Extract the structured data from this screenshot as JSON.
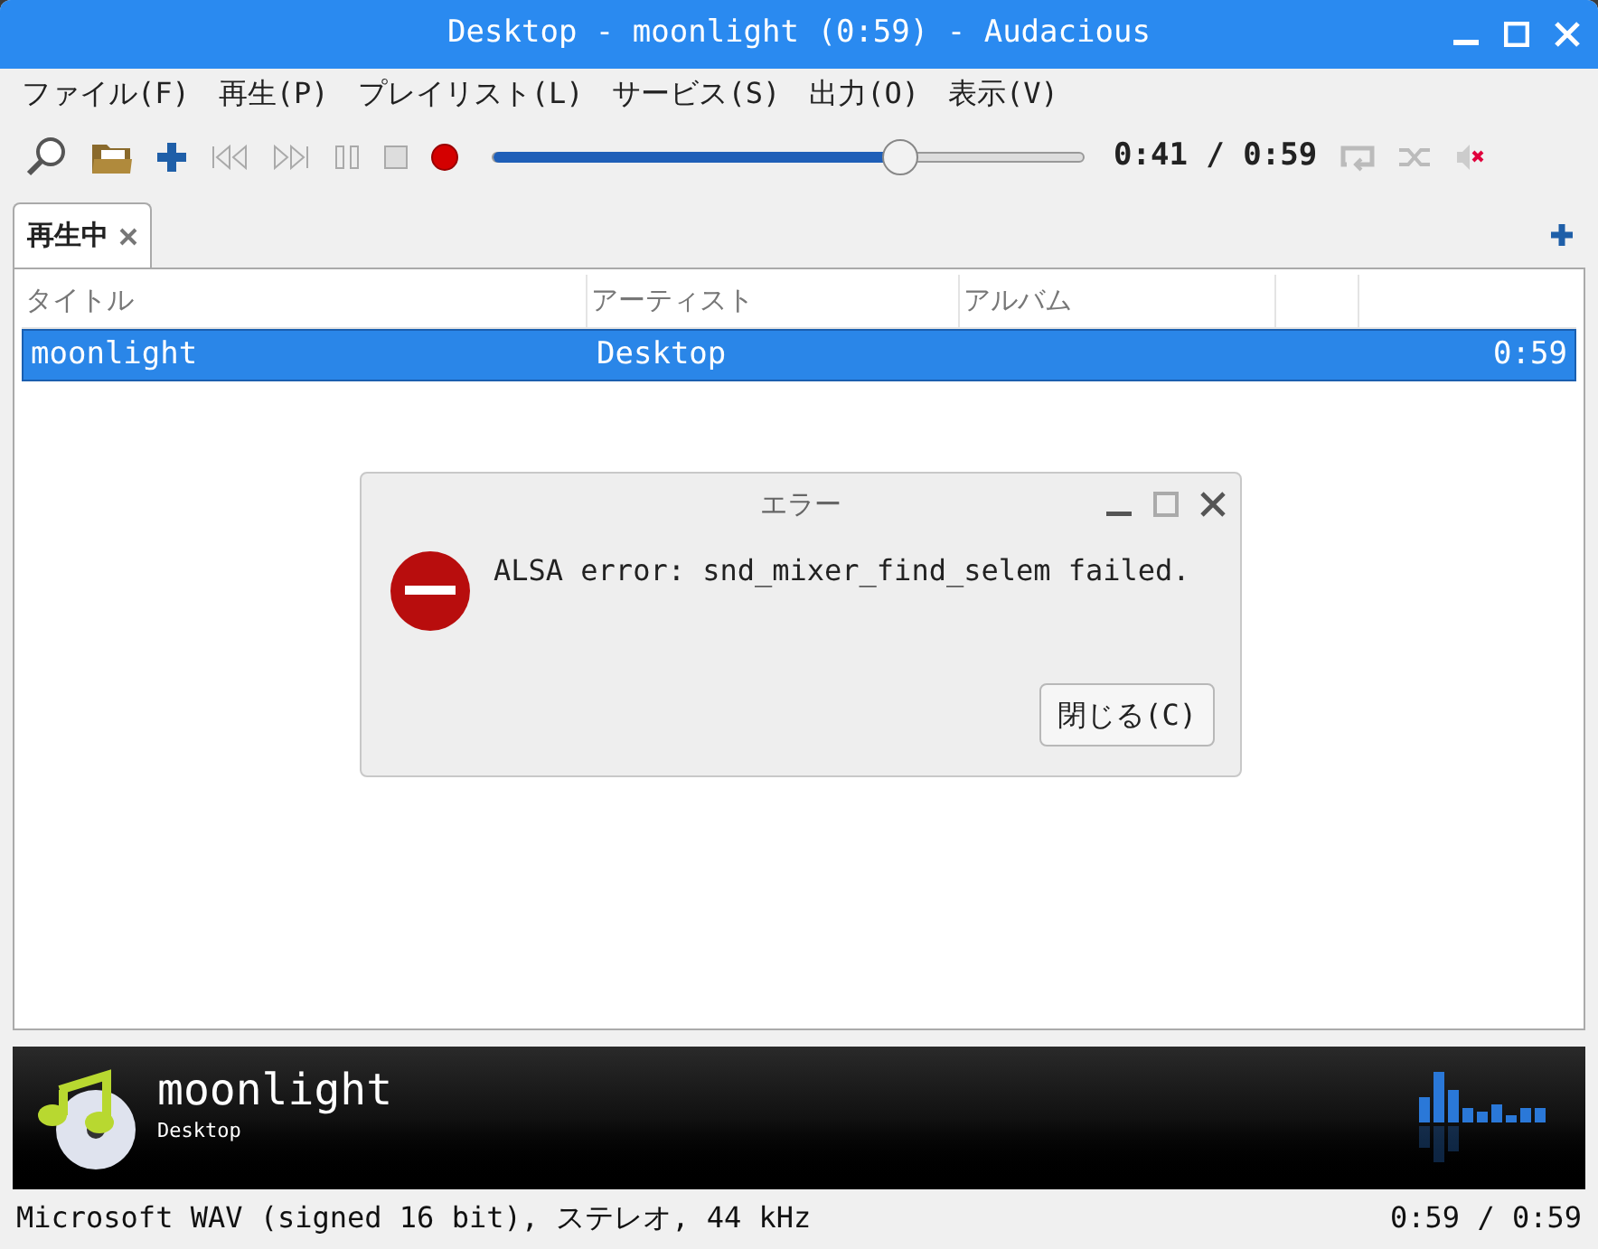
{
  "window": {
    "title": "Desktop - moonlight (0:59) - Audacious"
  },
  "menu": [
    "ファイル(F)",
    "再生(P)",
    "プレイリスト(L)",
    "サービス(S)",
    "出力(O)",
    "表示(V)"
  ],
  "toolbar": {
    "seek": {
      "level": 0.69
    },
    "time": "0:41 / 0:59"
  },
  "tabs": [
    {
      "label": "再生中",
      "selected": true
    }
  ],
  "playlist": {
    "columns": [
      "タイトル",
      "アーティスト",
      "アルバム"
    ],
    "rows": [
      {
        "title": "moonlight",
        "artist": "Desktop",
        "length": "0:59",
        "selected": true
      }
    ]
  },
  "dialog": {
    "title": "エラー",
    "message": "ALSA error: snd_mixer_find_selem failed.",
    "button": "閉じる(C)"
  },
  "now_playing": {
    "title": "moonlight",
    "artist": "Desktop"
  },
  "status_bar": {
    "format": "Microsoft WAV (signed 16 bit), ステレオ, 44 kHz",
    "time": "0:59 / 0:59"
  }
}
